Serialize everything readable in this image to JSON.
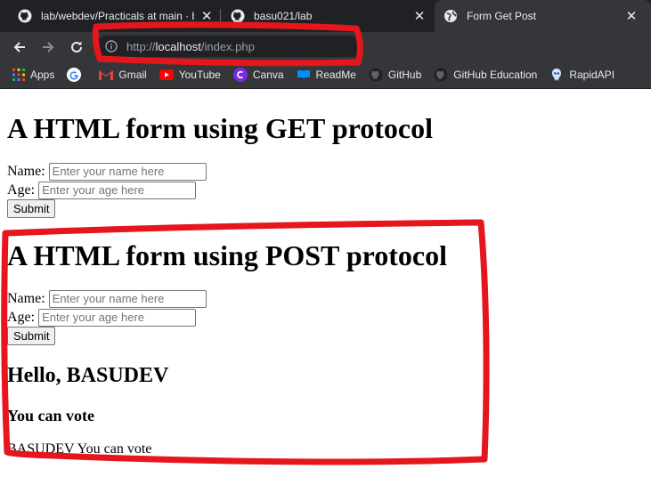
{
  "browser": {
    "tabs": [
      {
        "title": "lab/webdev/Practicals at main · b",
        "icon": "github-icon",
        "active": false
      },
      {
        "title": "basu021/lab",
        "icon": "github-icon",
        "active": false
      },
      {
        "title": "Form Get Post",
        "icon": "globe-icon",
        "active": true
      }
    ],
    "address": {
      "scheme": "http://",
      "host": "localhost",
      "path": "/index.php"
    },
    "bookmarks": [
      {
        "label": "Apps",
        "icon": "apps-grid-icon"
      },
      {
        "label": "",
        "icon": "google-icon"
      },
      {
        "label": "Gmail",
        "icon": "gmail-icon"
      },
      {
        "label": "YouTube",
        "icon": "youtube-icon"
      },
      {
        "label": "Canva",
        "icon": "canva-icon"
      },
      {
        "label": "ReadMe",
        "icon": "readme-icon"
      },
      {
        "label": "GitHub",
        "icon": "github-icon"
      },
      {
        "label": "GitHub Education",
        "icon": "github-icon"
      },
      {
        "label": "RapidAPI",
        "icon": "rapidapi-icon"
      }
    ],
    "colors": {
      "tabstrip": "#202124",
      "toolbar": "#35363a",
      "text": "#e8eaed"
    }
  },
  "page": {
    "get_form": {
      "heading": "A HTML form using GET protocol",
      "name_label": "Name:",
      "name_placeholder": "Enter your name here",
      "age_label": "Age:",
      "age_placeholder": "Enter your age here",
      "submit": "Submit"
    },
    "post_form": {
      "heading": "A HTML form using POST protocol",
      "name_label": "Name:",
      "name_placeholder": "Enter your name here",
      "age_label": "Age:",
      "age_placeholder": "Enter your age here",
      "submit": "Submit"
    },
    "result": {
      "greeting": "Hello, BASUDEV",
      "verdict": "You can vote",
      "message": "BASUDEV You can vote"
    }
  },
  "annotations": {
    "color": "#e5161c"
  }
}
